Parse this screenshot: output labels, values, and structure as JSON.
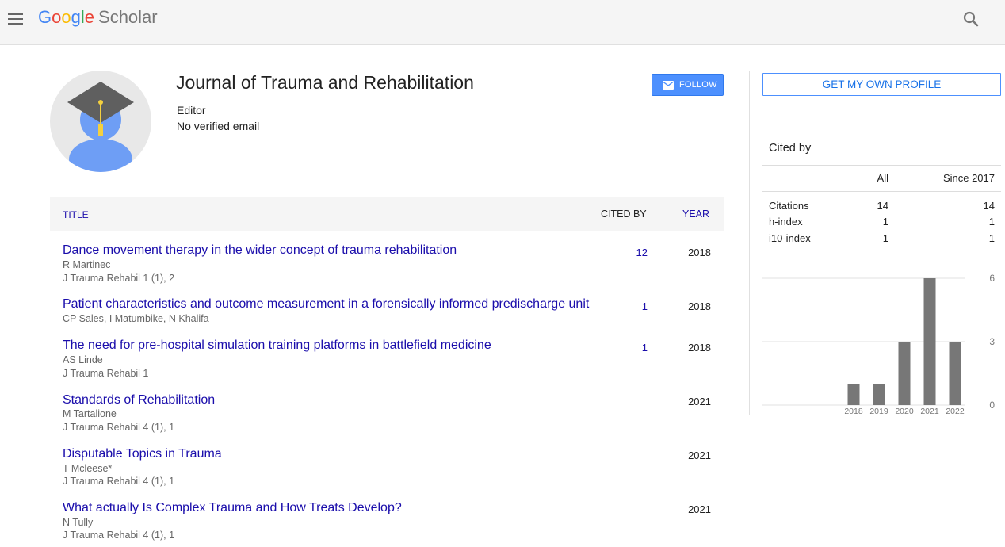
{
  "header": {
    "logo_google": [
      "G",
      "o",
      "o",
      "g",
      "l",
      "e"
    ],
    "logo_product": "Scholar"
  },
  "profile": {
    "name": "Journal of Trauma and Rehabilitation",
    "affiliation": "Editor",
    "email": "No verified email",
    "follow_label": "FOLLOW"
  },
  "table": {
    "headers": {
      "title": "TITLE",
      "cited_by": "CITED BY",
      "year": "YEAR"
    },
    "rows": [
      {
        "title": "Dance movement therapy in the wider concept of trauma rehabilitation",
        "authors": "R Martinec",
        "venue": "J Trauma Rehabil 1 (1), 2",
        "cited_by": "12",
        "year": "2018"
      },
      {
        "title": "Patient characteristics and outcome measurement in a forensically informed predischarge unit",
        "authors": "CP Sales, I Matumbike, N Khalifa",
        "venue": "",
        "cited_by": "1",
        "year": "2018"
      },
      {
        "title": "The need for pre-hospital simulation training platforms in battlefield medicine",
        "authors": "AS Linde",
        "venue": "J Trauma Rehabil 1",
        "cited_by": "1",
        "year": "2018"
      },
      {
        "title": "Standards of Rehabilitation",
        "authors": "M Tartalione",
        "venue": "J Trauma Rehabil 4 (1), 1",
        "cited_by": "",
        "year": "2021"
      },
      {
        "title": "Disputable Topics in Trauma",
        "authors": "T Mcleese*",
        "venue": "J Trauma Rehabil 4 (1), 1",
        "cited_by": "",
        "year": "2021"
      },
      {
        "title": "What actually Is Complex Trauma and How Treats Develop?",
        "authors": "N Tully",
        "venue": "J Trauma Rehabil 4 (1), 1",
        "cited_by": "",
        "year": "2021"
      }
    ]
  },
  "sidebar": {
    "get_profile_label": "GET MY OWN PROFILE",
    "cited_by_title": "Cited by",
    "col_all": "All",
    "col_since": "Since 2017",
    "stats": [
      {
        "label": "Citations",
        "all": "14",
        "since": "14"
      },
      {
        "label": "h-index",
        "all": "1",
        "since": "1"
      },
      {
        "label": "i10-index",
        "all": "1",
        "since": "1"
      }
    ]
  },
  "chart_data": {
    "type": "bar",
    "categories": [
      "2018",
      "2019",
      "2020",
      "2021",
      "2022"
    ],
    "values": [
      1,
      1,
      3,
      6,
      3
    ],
    "ylim": [
      0,
      6
    ],
    "yticks": [
      "0",
      "3",
      "6"
    ],
    "bar_color": "#777777",
    "grid": true
  }
}
